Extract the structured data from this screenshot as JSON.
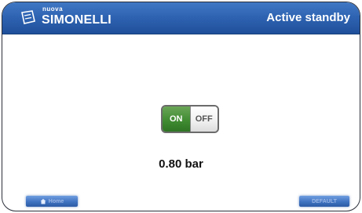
{
  "header": {
    "brand_small": "nuova",
    "brand_main": "SIMONELLI",
    "title": "Active standby"
  },
  "toggle": {
    "on_label": "ON",
    "off_label": "OFF",
    "state": "on"
  },
  "pressure": {
    "value": "0.80 bar"
  },
  "footer": {
    "home_label": "Home",
    "default_label": "DEFAULT"
  },
  "colors": {
    "header": "#2f64b3",
    "toggle_on": "#3e8a30",
    "button": "#3f72c0"
  }
}
